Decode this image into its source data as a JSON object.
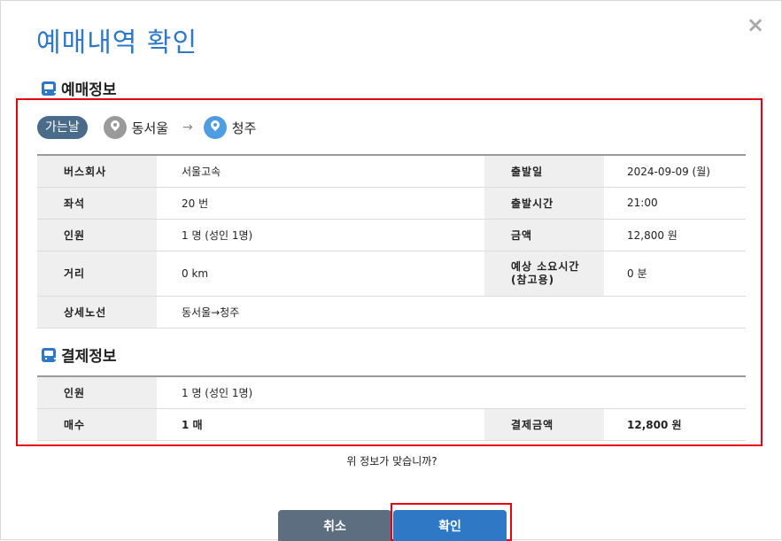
{
  "dialog": {
    "title": "예매내역 확인",
    "close_symbol": "×"
  },
  "reservation": {
    "heading": "예매정보",
    "route": {
      "trip_badge": "가는날",
      "origin": "동서울",
      "arrow": "→",
      "destination": "청주"
    },
    "rows": {
      "company_label": "버스회사",
      "company_value": "서울고속",
      "date_label": "출발일",
      "date_value": "2024-09-09 (월)",
      "seat_label": "좌석",
      "seat_value": "20 번",
      "time_label": "출발시간",
      "time_value": "21:00",
      "people_label": "인원",
      "people_value": "1 명 (성인 1명)",
      "amount_label": "금액",
      "amount_value": "12,800 원",
      "distance_label": "거리",
      "distance_value": "0 km",
      "duration_label": "예상 소요시간\n(참고용)",
      "duration_value": "0 분",
      "route_label": "상세노선",
      "route_value": "동서울→청주"
    }
  },
  "payment": {
    "heading": "결제정보",
    "people_label": "인원",
    "people_value": "1 명 (성인 1명)",
    "count_label": "매수",
    "count_value": "1 매",
    "total_label": "결제금액",
    "total_value": "12,800 원"
  },
  "question": "위 정보가 맞습니까?",
  "buttons": {
    "cancel": "취소",
    "confirm": "확인"
  },
  "colors": {
    "accent": "#2f78c6",
    "highlight": "#e60012",
    "cancel": "#5c6e80"
  },
  "icons": {
    "section": "bus-icon",
    "origin": "location-pin-icon",
    "destination": "location-pin-icon"
  }
}
